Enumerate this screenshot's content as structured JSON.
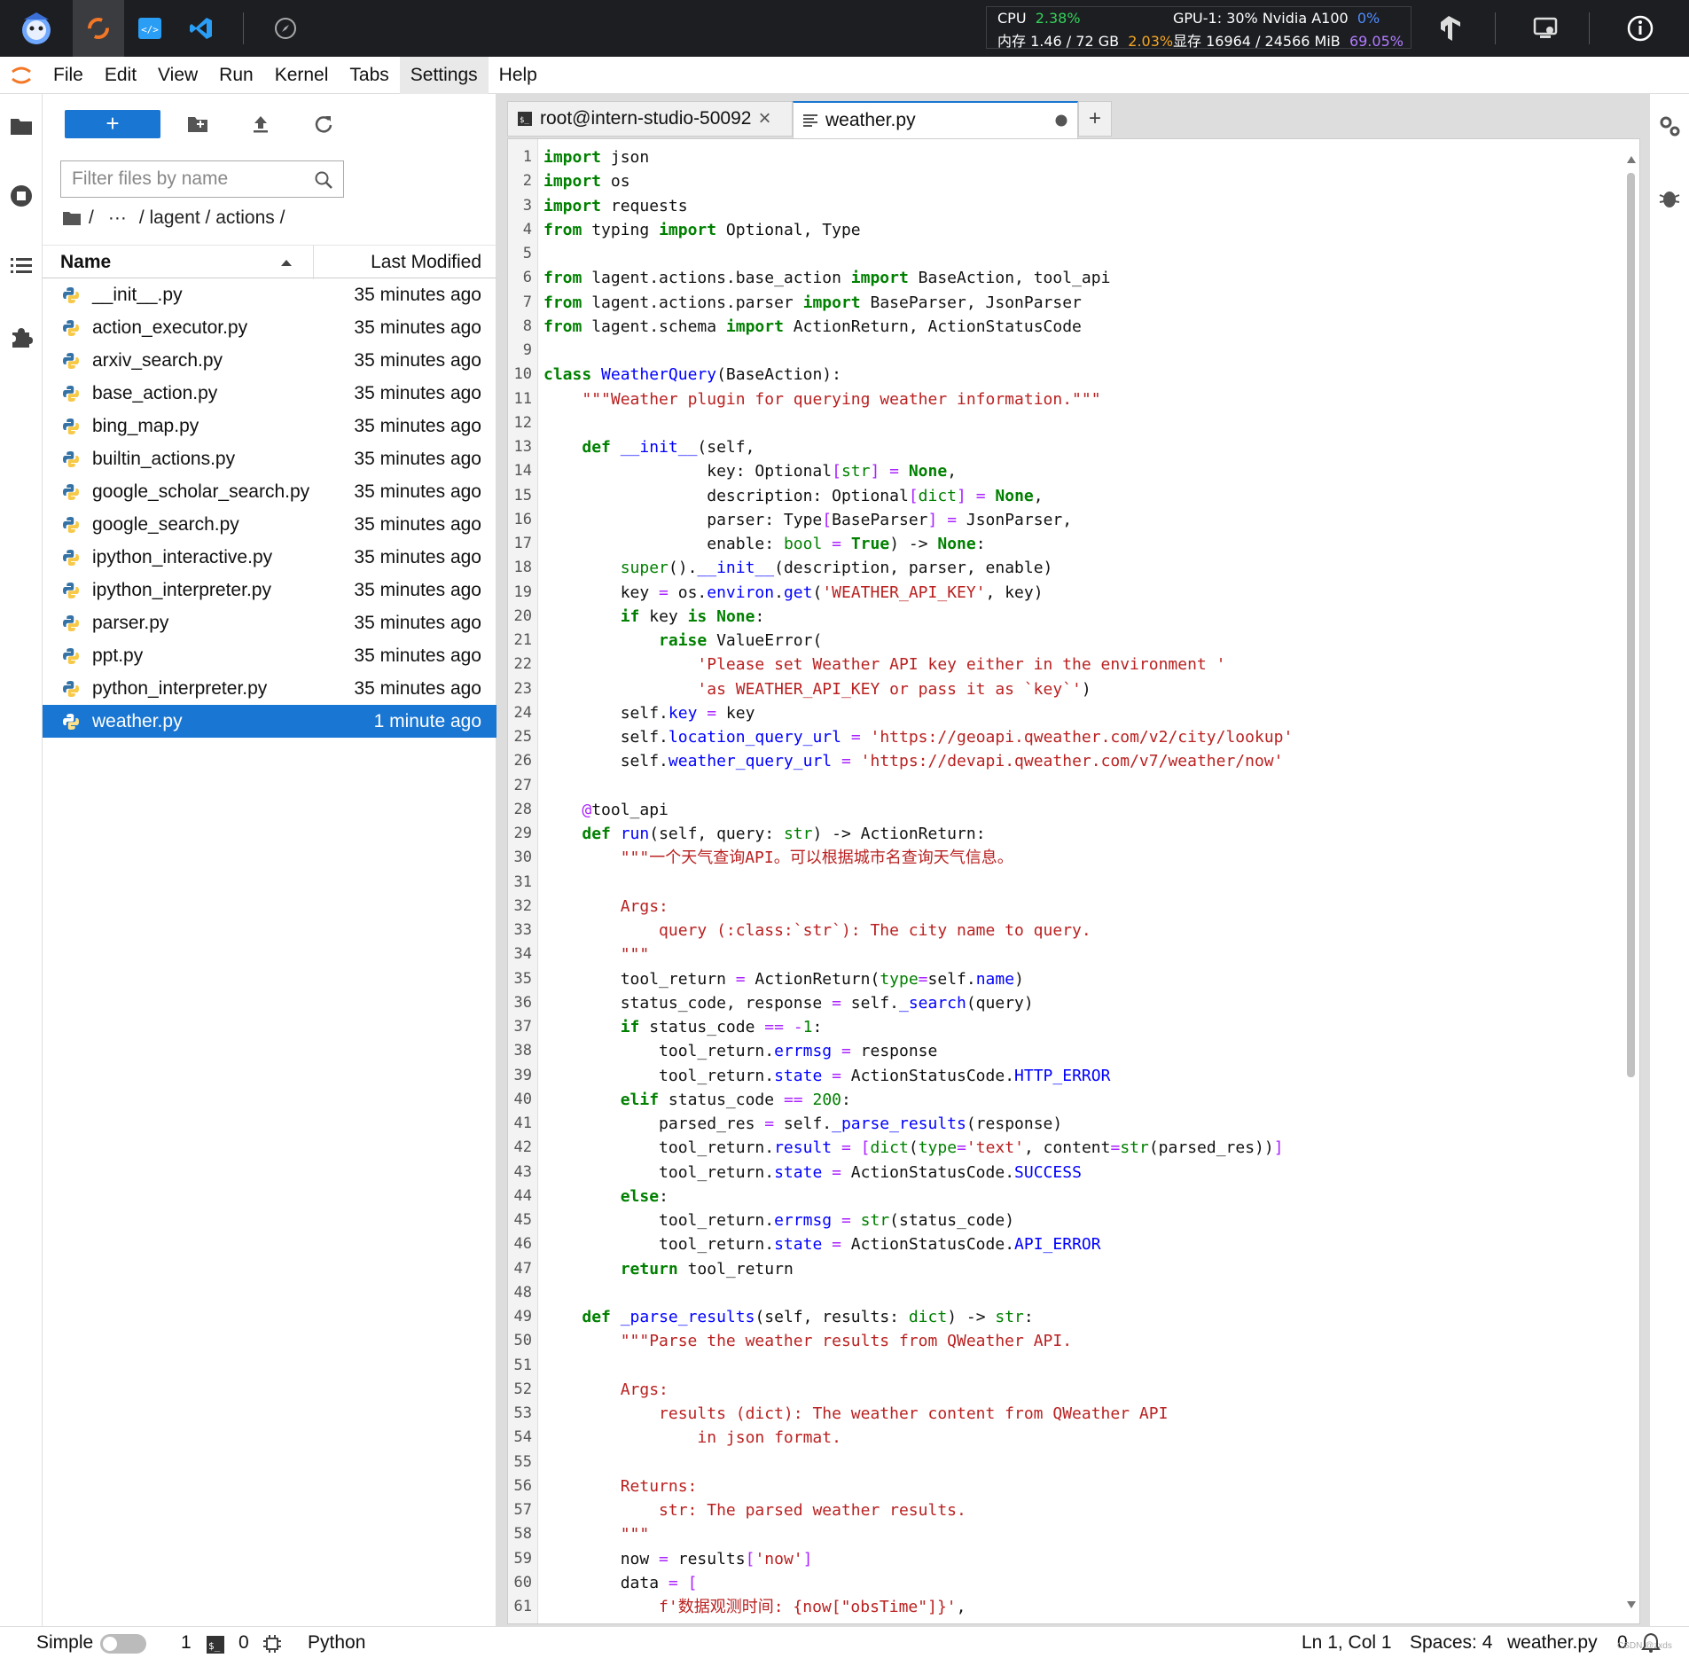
{
  "topbar": {
    "cpu_label": "CPU",
    "cpu_pct": "2.38%",
    "mem_label": "内存 1.46 / 72 GB",
    "mem_pct": "2.03%",
    "gpu_label": "GPU-1: 30% Nvidia A100",
    "gpu_pct": "0%",
    "vram_label": "显存 16964 / 24566 MiB",
    "vram_pct": "69.05%"
  },
  "menu": [
    "File",
    "Edit",
    "View",
    "Run",
    "Kernel",
    "Tabs",
    "Settings",
    "Help"
  ],
  "filebrowser": {
    "new_label": "+",
    "filter_placeholder": "Filter files by name",
    "breadcrumb": [
      "/",
      "···",
      "/ lagent / actions /"
    ],
    "col_name": "Name",
    "col_modified": "Last Modified",
    "files": [
      {
        "name": "__init__.py",
        "modified": "35 minutes ago"
      },
      {
        "name": "action_executor.py",
        "modified": "35 minutes ago"
      },
      {
        "name": "arxiv_search.py",
        "modified": "35 minutes ago"
      },
      {
        "name": "base_action.py",
        "modified": "35 minutes ago"
      },
      {
        "name": "bing_map.py",
        "modified": "35 minutes ago"
      },
      {
        "name": "builtin_actions.py",
        "modified": "35 minutes ago"
      },
      {
        "name": "google_scholar_search.py",
        "modified": "35 minutes ago"
      },
      {
        "name": "google_search.py",
        "modified": "35 minutes ago"
      },
      {
        "name": "ipython_interactive.py",
        "modified": "35 minutes ago"
      },
      {
        "name": "ipython_interpreter.py",
        "modified": "35 minutes ago"
      },
      {
        "name": "parser.py",
        "modified": "35 minutes ago"
      },
      {
        "name": "ppt.py",
        "modified": "35 minutes ago"
      },
      {
        "name": "python_interpreter.py",
        "modified": "35 minutes ago"
      },
      {
        "name": "weather.py",
        "modified": "1 minute ago",
        "selected": true
      }
    ]
  },
  "tabs": [
    {
      "label": "root@intern-studio-50092",
      "close": "×"
    },
    {
      "label": "weather.py"
    }
  ],
  "tab_add": "+",
  "code": [
    [
      [
        "k",
        "import"
      ],
      [
        "t",
        " json"
      ]
    ],
    [
      [
        "k",
        "import"
      ],
      [
        "t",
        " os"
      ]
    ],
    [
      [
        "k",
        "import"
      ],
      [
        "t",
        " requests"
      ]
    ],
    [
      [
        "k",
        "from"
      ],
      [
        "t",
        " typing "
      ],
      [
        "k",
        "import"
      ],
      [
        "t",
        " Optional, Type"
      ]
    ],
    [],
    [
      [
        "k",
        "from"
      ],
      [
        "t",
        " lagent.actions.base_action "
      ],
      [
        "k",
        "import"
      ],
      [
        "t",
        " BaseAction, tool_api"
      ]
    ],
    [
      [
        "k",
        "from"
      ],
      [
        "t",
        " lagent.actions.parser "
      ],
      [
        "k",
        "import"
      ],
      [
        "t",
        " BaseParser, JsonParser"
      ]
    ],
    [
      [
        "k",
        "from"
      ],
      [
        "t",
        " lagent.schema "
      ],
      [
        "k",
        "import"
      ],
      [
        "t",
        " ActionReturn, ActionStatusCode"
      ]
    ],
    [],
    [
      [
        "k",
        "class"
      ],
      [
        "t",
        " "
      ],
      [
        "f",
        "WeatherQuery"
      ],
      [
        "t",
        "(BaseAction):"
      ]
    ],
    [
      [
        "t",
        "    "
      ],
      [
        "s",
        "\"\"\"Weather plugin for querying weather information.\"\"\""
      ]
    ],
    [],
    [
      [
        "t",
        "    "
      ],
      [
        "k",
        "def"
      ],
      [
        "t",
        " "
      ],
      [
        "f",
        "__init__"
      ],
      [
        "t",
        "(self,"
      ]
    ],
    [
      [
        "t",
        "                 key: Optional"
      ],
      [
        "op",
        "["
      ],
      [
        "bi",
        "str"
      ],
      [
        "op",
        "]"
      ],
      [
        "t",
        " "
      ],
      [
        "op",
        "="
      ],
      [
        "t",
        " "
      ],
      [
        "k",
        "None"
      ],
      [
        "t",
        ","
      ]
    ],
    [
      [
        "t",
        "                 description: Optional"
      ],
      [
        "op",
        "["
      ],
      [
        "bi",
        "dict"
      ],
      [
        "op",
        "]"
      ],
      [
        "t",
        " "
      ],
      [
        "op",
        "="
      ],
      [
        "t",
        " "
      ],
      [
        "k",
        "None"
      ],
      [
        "t",
        ","
      ]
    ],
    [
      [
        "t",
        "                 parser: Type"
      ],
      [
        "op",
        "["
      ],
      [
        "t",
        "BaseParser"
      ],
      [
        "op",
        "]"
      ],
      [
        "t",
        " "
      ],
      [
        "op",
        "="
      ],
      [
        "t",
        " JsonParser,"
      ]
    ],
    [
      [
        "t",
        "                 enable: "
      ],
      [
        "bi",
        "bool"
      ],
      [
        "t",
        " "
      ],
      [
        "op",
        "="
      ],
      [
        "t",
        " "
      ],
      [
        "k",
        "True"
      ],
      [
        "t",
        ") -> "
      ],
      [
        "k",
        "None"
      ],
      [
        "t",
        ":"
      ]
    ],
    [
      [
        "t",
        "        "
      ],
      [
        "bi",
        "super"
      ],
      [
        "t",
        "()."
      ],
      [
        "f",
        "__init__"
      ],
      [
        "t",
        "(description, parser, enable)"
      ]
    ],
    [
      [
        "t",
        "        key "
      ],
      [
        "op",
        "="
      ],
      [
        "t",
        " os."
      ],
      [
        "f",
        "environ"
      ],
      [
        "t",
        "."
      ],
      [
        "f",
        "get"
      ],
      [
        "t",
        "("
      ],
      [
        "s",
        "'WEATHER_API_KEY'"
      ],
      [
        "t",
        ", key)"
      ]
    ],
    [
      [
        "t",
        "        "
      ],
      [
        "k",
        "if"
      ],
      [
        "t",
        " key "
      ],
      [
        "k",
        "is"
      ],
      [
        "t",
        " "
      ],
      [
        "k",
        "None"
      ],
      [
        "t",
        ":"
      ]
    ],
    [
      [
        "t",
        "            "
      ],
      [
        "k",
        "raise"
      ],
      [
        "t",
        " ValueError("
      ]
    ],
    [
      [
        "t",
        "                "
      ],
      [
        "s",
        "'Please set Weather API key either in the environment '"
      ]
    ],
    [
      [
        "t",
        "                "
      ],
      [
        "s",
        "'as WEATHER_API_KEY or pass it as `key`'"
      ],
      [
        "t",
        ")"
      ]
    ],
    [
      [
        "t",
        "        self."
      ],
      [
        "f",
        "key"
      ],
      [
        "t",
        " "
      ],
      [
        "op",
        "="
      ],
      [
        "t",
        " key"
      ]
    ],
    [
      [
        "t",
        "        self."
      ],
      [
        "f",
        "location_query_url"
      ],
      [
        "t",
        " "
      ],
      [
        "op",
        "="
      ],
      [
        "t",
        " "
      ],
      [
        "s",
        "'https://geoapi.qweather.com/v2/city/lookup'"
      ]
    ],
    [
      [
        "t",
        "        self."
      ],
      [
        "f",
        "weather_query_url"
      ],
      [
        "t",
        " "
      ],
      [
        "op",
        "="
      ],
      [
        "t",
        " "
      ],
      [
        "s",
        "'https://devapi.qweather.com/v7/weather/now'"
      ]
    ],
    [],
    [
      [
        "t",
        "    "
      ],
      [
        "dec",
        "@"
      ],
      [
        "t",
        "tool_api"
      ]
    ],
    [
      [
        "t",
        "    "
      ],
      [
        "k",
        "def"
      ],
      [
        "t",
        " "
      ],
      [
        "f",
        "run"
      ],
      [
        "t",
        "(self, query: "
      ],
      [
        "bi",
        "str"
      ],
      [
        "t",
        ") -> ActionReturn:"
      ]
    ],
    [
      [
        "t",
        "        "
      ],
      [
        "s",
        "\"\"\"一个天气查询API。可以根据城市名查询天气信息。"
      ]
    ],
    [],
    [
      [
        "t",
        "        "
      ],
      [
        "s",
        "Args:"
      ]
    ],
    [
      [
        "t",
        "            "
      ],
      [
        "s",
        "query (:class:`str`): The city name to query."
      ]
    ],
    [
      [
        "t",
        "        "
      ],
      [
        "s",
        "\"\"\""
      ]
    ],
    [
      [
        "t",
        "        tool_return "
      ],
      [
        "op",
        "="
      ],
      [
        "t",
        " ActionReturn("
      ],
      [
        "bi",
        "type"
      ],
      [
        "op",
        "="
      ],
      [
        "t",
        "self."
      ],
      [
        "f",
        "name"
      ],
      [
        "t",
        ")"
      ]
    ],
    [
      [
        "t",
        "        status_code, response "
      ],
      [
        "op",
        "="
      ],
      [
        "t",
        " self."
      ],
      [
        "f",
        "_search"
      ],
      [
        "t",
        "(query)"
      ]
    ],
    [
      [
        "t",
        "        "
      ],
      [
        "k",
        "if"
      ],
      [
        "t",
        " status_code "
      ],
      [
        "op",
        "=="
      ],
      [
        "t",
        " "
      ],
      [
        "op",
        "-"
      ],
      [
        "nu",
        "1"
      ],
      [
        "t",
        ":"
      ]
    ],
    [
      [
        "t",
        "            tool_return."
      ],
      [
        "f",
        "errmsg"
      ],
      [
        "t",
        " "
      ],
      [
        "op",
        "="
      ],
      [
        "t",
        " response"
      ]
    ],
    [
      [
        "t",
        "            tool_return."
      ],
      [
        "f",
        "state"
      ],
      [
        "t",
        " "
      ],
      [
        "op",
        "="
      ],
      [
        "t",
        " ActionStatusCode."
      ],
      [
        "f",
        "HTTP_ERROR"
      ]
    ],
    [
      [
        "t",
        "        "
      ],
      [
        "k",
        "elif"
      ],
      [
        "t",
        " status_code "
      ],
      [
        "op",
        "=="
      ],
      [
        "t",
        " "
      ],
      [
        "nu",
        "200"
      ],
      [
        "t",
        ":"
      ]
    ],
    [
      [
        "t",
        "            parsed_res "
      ],
      [
        "op",
        "="
      ],
      [
        "t",
        " self."
      ],
      [
        "f",
        "_parse_results"
      ],
      [
        "t",
        "(response)"
      ]
    ],
    [
      [
        "t",
        "            tool_return."
      ],
      [
        "f",
        "result"
      ],
      [
        "t",
        " "
      ],
      [
        "op",
        "="
      ],
      [
        "t",
        " "
      ],
      [
        "op",
        "["
      ],
      [
        "bi",
        "dict"
      ],
      [
        "t",
        "("
      ],
      [
        "bi",
        "type"
      ],
      [
        "op",
        "="
      ],
      [
        "s",
        "'text'"
      ],
      [
        "t",
        ", content"
      ],
      [
        "op",
        "="
      ],
      [
        "bi",
        "str"
      ],
      [
        "t",
        "(parsed_res))"
      ],
      [
        "op",
        "]"
      ]
    ],
    [
      [
        "t",
        "            tool_return."
      ],
      [
        "f",
        "state"
      ],
      [
        "t",
        " "
      ],
      [
        "op",
        "="
      ],
      [
        "t",
        " ActionStatusCode."
      ],
      [
        "f",
        "SUCCESS"
      ]
    ],
    [
      [
        "t",
        "        "
      ],
      [
        "k",
        "else"
      ],
      [
        "t",
        ":"
      ]
    ],
    [
      [
        "t",
        "            tool_return."
      ],
      [
        "f",
        "errmsg"
      ],
      [
        "t",
        " "
      ],
      [
        "op",
        "="
      ],
      [
        "t",
        " "
      ],
      [
        "bi",
        "str"
      ],
      [
        "t",
        "(status_code)"
      ]
    ],
    [
      [
        "t",
        "            tool_return."
      ],
      [
        "f",
        "state"
      ],
      [
        "t",
        " "
      ],
      [
        "op",
        "="
      ],
      [
        "t",
        " ActionStatusCode."
      ],
      [
        "f",
        "API_ERROR"
      ]
    ],
    [
      [
        "t",
        "        "
      ],
      [
        "k",
        "return"
      ],
      [
        "t",
        " tool_return"
      ]
    ],
    [],
    [
      [
        "t",
        "    "
      ],
      [
        "k",
        "def"
      ],
      [
        "t",
        " "
      ],
      [
        "f",
        "_parse_results"
      ],
      [
        "t",
        "(self, results: "
      ],
      [
        "bi",
        "dict"
      ],
      [
        "t",
        ") -> "
      ],
      [
        "bi",
        "str"
      ],
      [
        "t",
        ":"
      ]
    ],
    [
      [
        "t",
        "        "
      ],
      [
        "s",
        "\"\"\"Parse the weather results from QWeather API."
      ]
    ],
    [],
    [
      [
        "t",
        "        "
      ],
      [
        "s",
        "Args:"
      ]
    ],
    [
      [
        "t",
        "            "
      ],
      [
        "s",
        "results (dict): The weather content from QWeather API"
      ]
    ],
    [
      [
        "t",
        "                "
      ],
      [
        "s",
        "in json format."
      ]
    ],
    [],
    [
      [
        "t",
        "        "
      ],
      [
        "s",
        "Returns:"
      ]
    ],
    [
      [
        "t",
        "            "
      ],
      [
        "s",
        "str: The parsed weather results."
      ]
    ],
    [
      [
        "t",
        "        "
      ],
      [
        "s",
        "\"\"\""
      ]
    ],
    [
      [
        "t",
        "        now "
      ],
      [
        "op",
        "="
      ],
      [
        "t",
        " results"
      ],
      [
        "op",
        "["
      ],
      [
        "s",
        "'now'"
      ],
      [
        "op",
        "]"
      ]
    ],
    [
      [
        "t",
        "        data "
      ],
      [
        "op",
        "="
      ],
      [
        "t",
        " "
      ],
      [
        "op",
        "["
      ]
    ],
    [
      [
        "t",
        "            "
      ],
      [
        "s",
        "f'数据观测时间: {now[\"obsTime\"]}'"
      ],
      [
        "t",
        ","
      ]
    ]
  ],
  "statusbar": {
    "mode": "Simple",
    "terminals": "1",
    "kernels": "0",
    "kernel_name": "Python",
    "position": "Ln 1, Col 1",
    "spaces": "Spaces: 4",
    "filename": "weather.py",
    "notifications": "0",
    "watermark": "CSDN @zxds"
  }
}
